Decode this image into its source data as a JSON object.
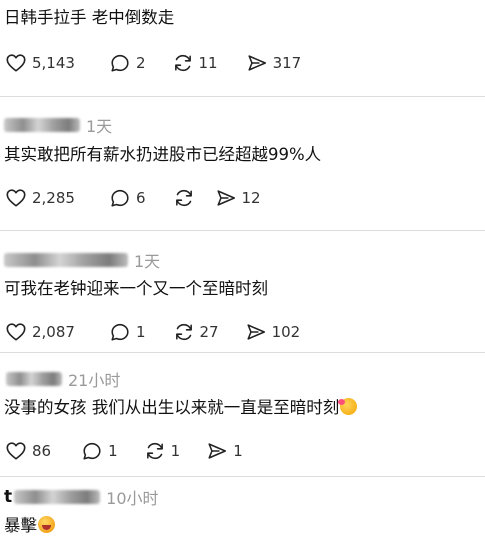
{
  "posts": [
    {
      "text": "日韩手拉手 老中倒数走",
      "likes": "5,143",
      "comments": "2",
      "reposts": "11",
      "shares": "317"
    },
    {
      "time": "1天",
      "text": "其实敢把所有薪水扔进股市已经超越99%人",
      "likes": "2,285",
      "comments": "6",
      "reposts": "",
      "shares": "12"
    },
    {
      "time": "1天",
      "text": "可我在老钟迎来一个又一个至暗时刻",
      "likes": "2,087",
      "comments": "1",
      "reposts": "27",
      "shares": "102"
    },
    {
      "time": "21小时",
      "text": "没事的女孩 我们从出生以来就一直是至暗时刻",
      "likes": "86",
      "comments": "1",
      "reposts": "1",
      "shares": "1",
      "emoji": "smiling-face-with-hearts"
    },
    {
      "username_prefix": "t",
      "time": "10小时",
      "text": "暴擊",
      "emoji": "laughing-face"
    }
  ],
  "icons": {
    "like": "heart-icon",
    "comment": "comment-bubble-icon",
    "repost": "repost-icon",
    "share": "send-icon"
  }
}
